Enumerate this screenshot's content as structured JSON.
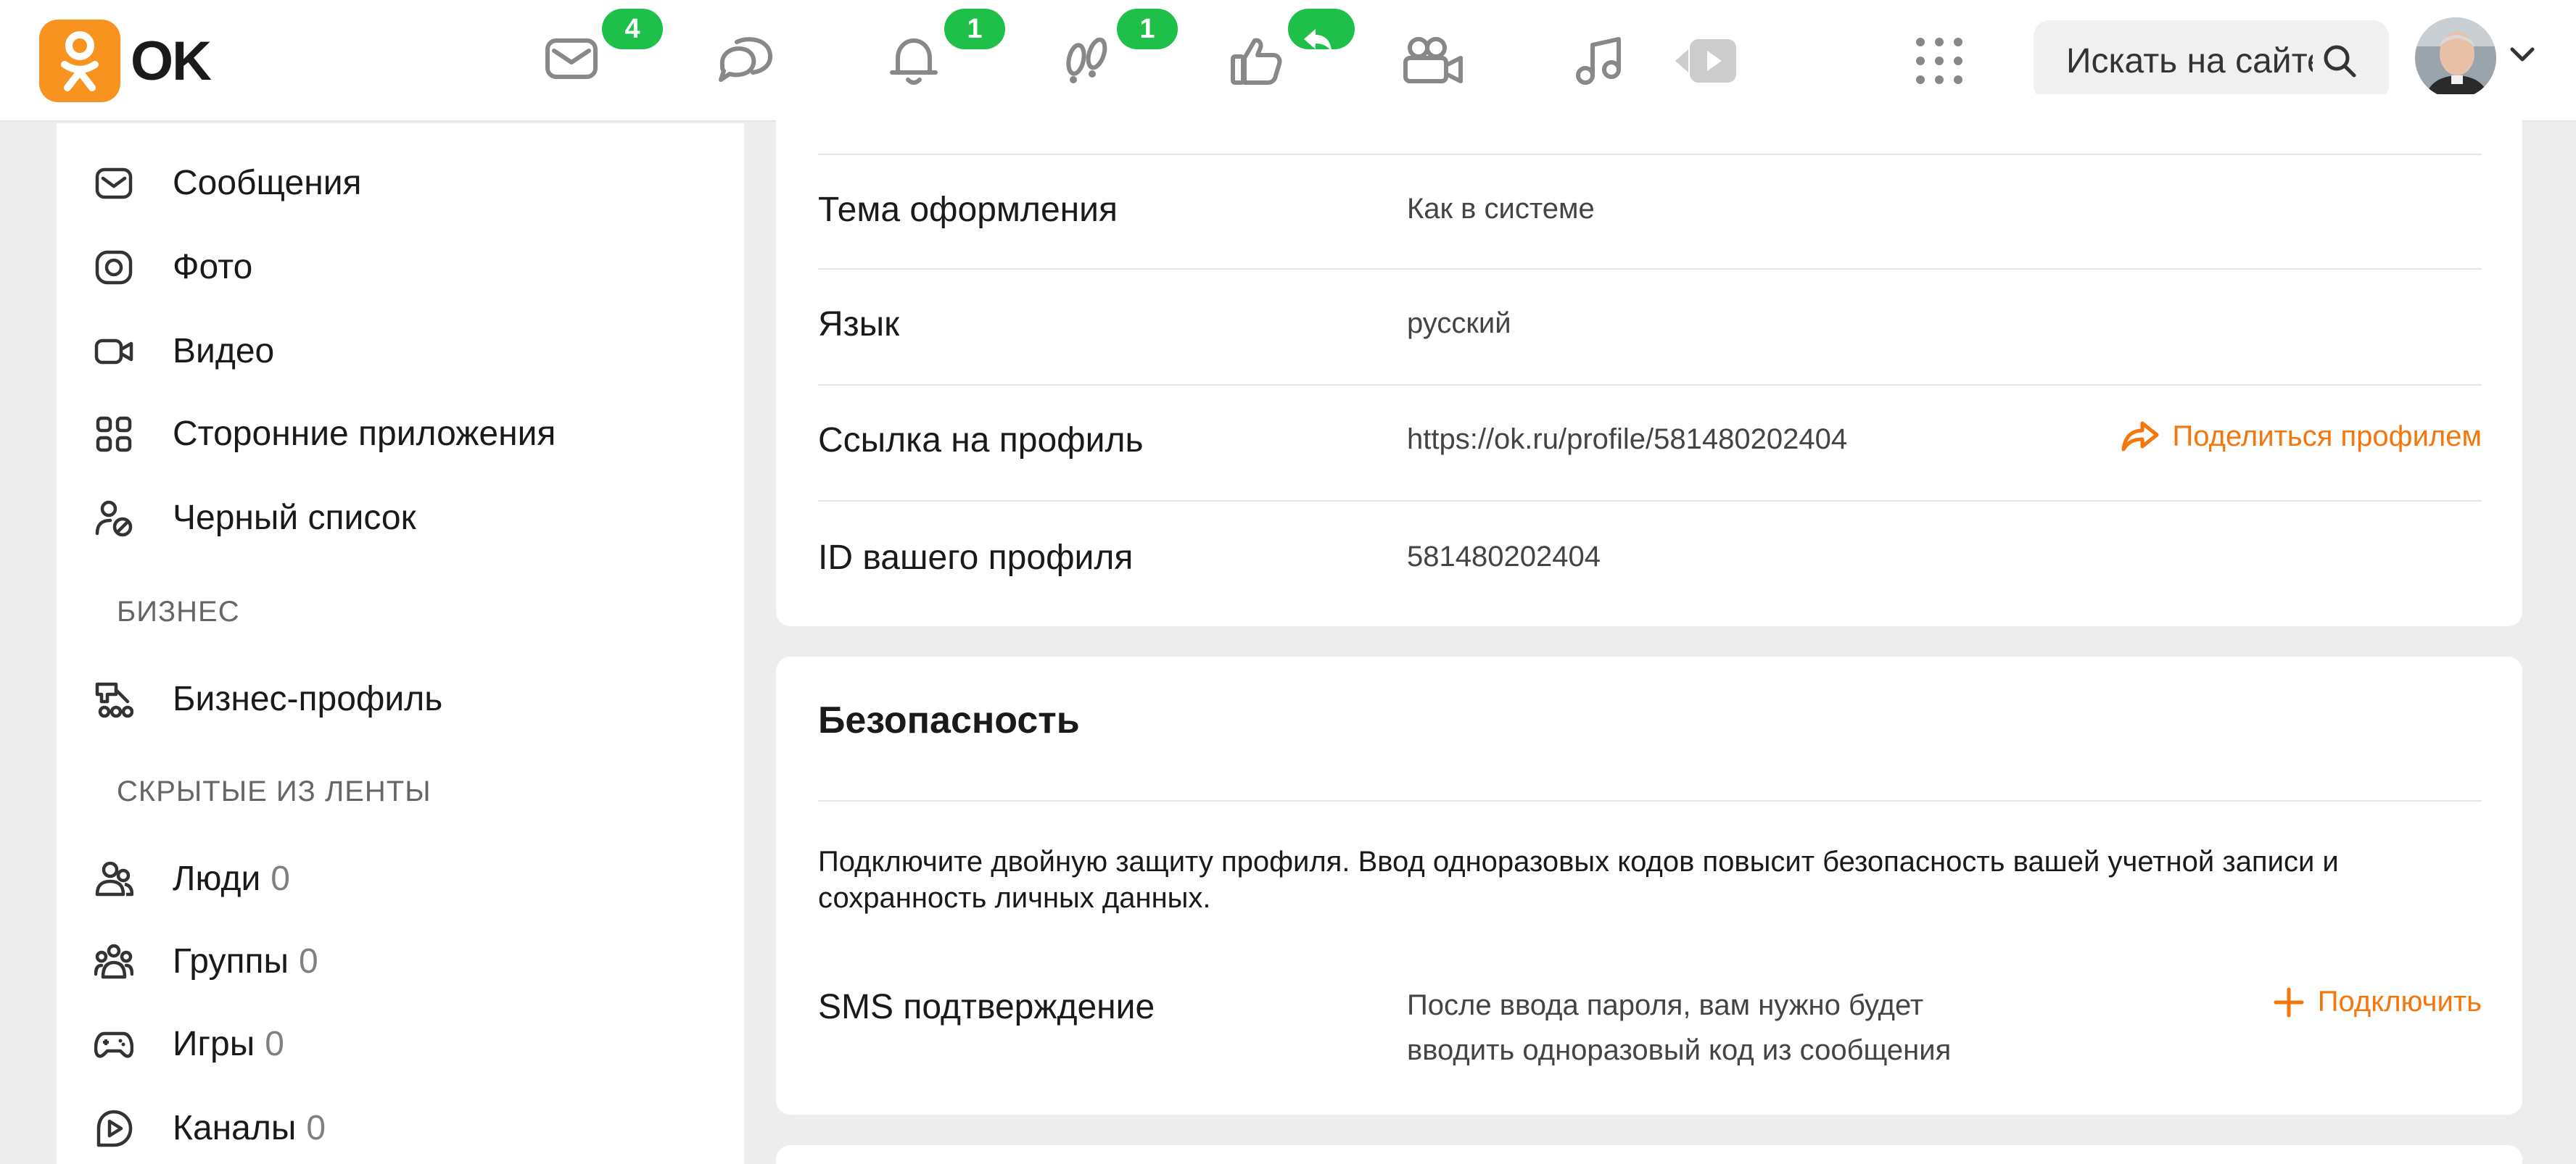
{
  "header": {
    "logo_text": "OK",
    "brand_color": "#f7931e",
    "nav": [
      {
        "name": "messages",
        "icon": "envelope-icon",
        "badge": "4"
      },
      {
        "name": "discussions",
        "icon": "chat-bubbles-icon",
        "badge": ""
      },
      {
        "name": "notifications",
        "icon": "bell-icon",
        "badge": "1"
      },
      {
        "name": "guests",
        "icon": "footprints-icon",
        "badge": "1"
      },
      {
        "name": "events",
        "icon": "thumbs-up-icon",
        "badge": "reply-arrow"
      },
      {
        "name": "video-calls",
        "icon": "video-camera-icon",
        "badge": ""
      },
      {
        "name": "music",
        "icon": "music-note-icon",
        "badge": ""
      },
      {
        "name": "video",
        "icon": "play-icon",
        "badge": ""
      }
    ],
    "badge_color": "#1ec04a",
    "search_placeholder": "Искать на сайте"
  },
  "sidebar": {
    "items": [
      {
        "label": "Сообщения",
        "icon": "envelope-icon"
      },
      {
        "label": "Фото",
        "icon": "camera-icon"
      },
      {
        "label": "Видео",
        "icon": "video-camera-icon"
      },
      {
        "label": "Сторонние приложения",
        "icon": "apps-grid-icon"
      },
      {
        "label": "Черный список",
        "icon": "user-blocked-icon"
      }
    ],
    "business_heading": "БИЗНЕС",
    "business_items": [
      {
        "label": "Бизнес-профиль",
        "icon": "business-profile-icon"
      }
    ],
    "hidden_heading": "СКРЫТЫЕ ИЗ ЛЕНТЫ",
    "hidden_items": [
      {
        "label": "Люди",
        "count": "0",
        "icon": "people-icon"
      },
      {
        "label": "Группы",
        "count": "0",
        "icon": "groups-icon"
      },
      {
        "label": "Игры",
        "count": "0",
        "icon": "gamepad-icon"
      },
      {
        "label": "Каналы",
        "count": "0",
        "icon": "channel-play-icon"
      }
    ]
  },
  "profile_settings": {
    "rows": [
      {
        "label": "Тема оформления",
        "value": "Как в системе"
      },
      {
        "label": "Язык",
        "value": "русский"
      },
      {
        "label": "Ссылка на профиль",
        "value": "https://ok.ru/profile/581480202404",
        "action": "Поделиться профилем"
      },
      {
        "label": "ID вашего профиля",
        "value": "581480202404"
      }
    ]
  },
  "security": {
    "title": "Безопасность",
    "description": "Подключите двойную защиту профиля. Ввод одноразовых кодов повысит безопасность вашей учетной записи и сохранность личных данных.",
    "sms_label": "SMS подтверждение",
    "sms_description": "После ввода пароля, вам нужно будет вводить одноразовый код из сообщения",
    "connect_label": "Подключить"
  },
  "accent_color": "#f7760b"
}
